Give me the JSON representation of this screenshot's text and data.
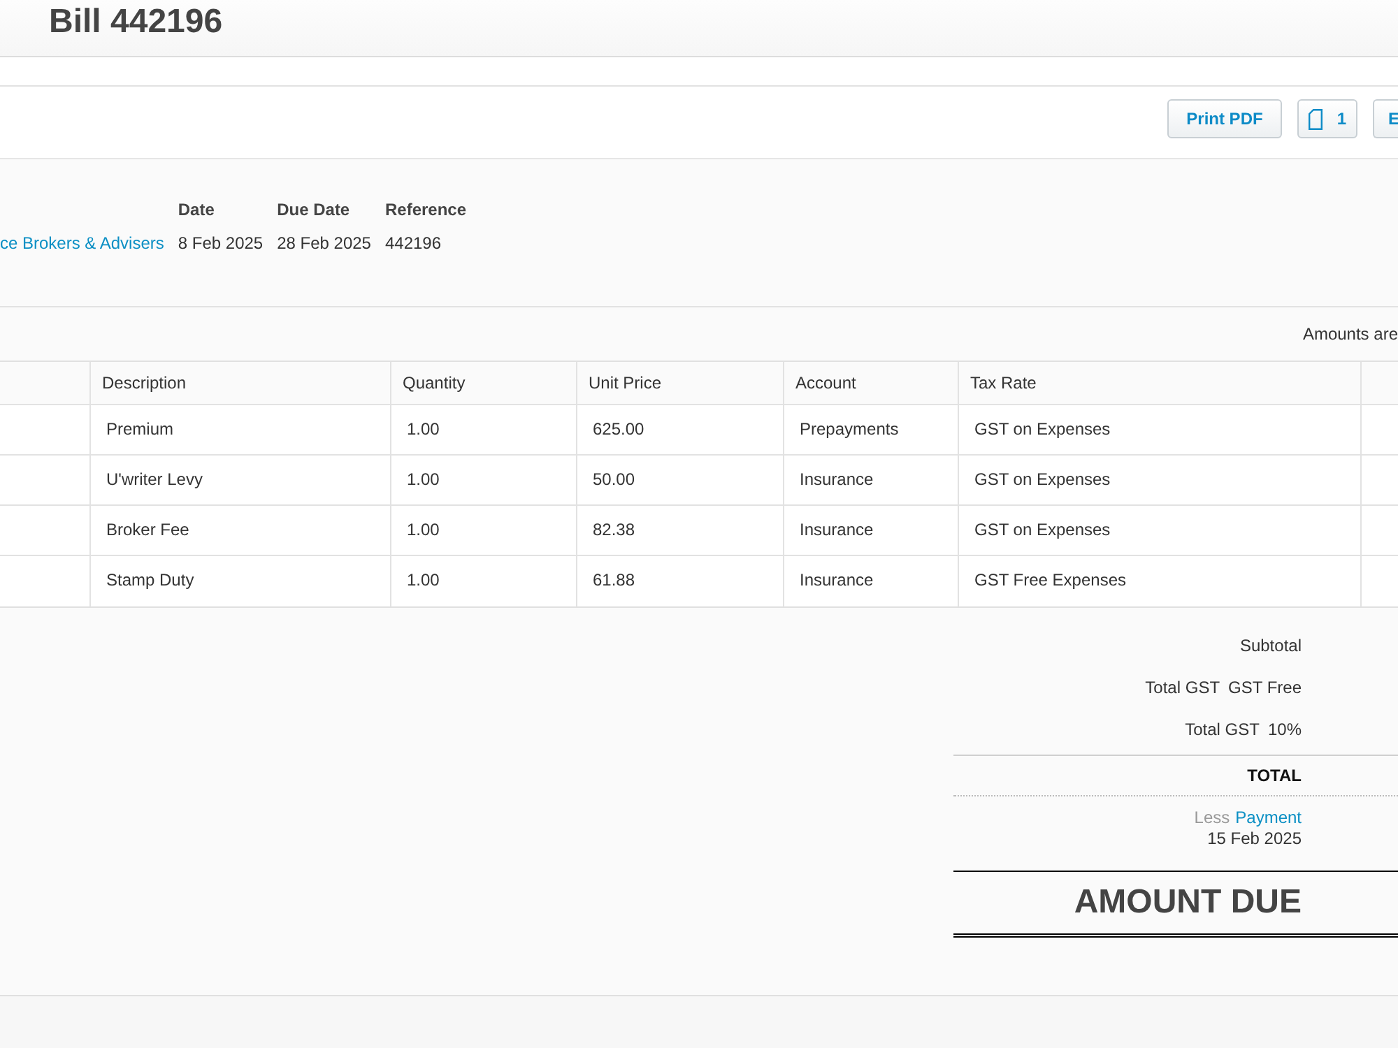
{
  "header": {
    "title": "Bill 442196"
  },
  "toolbar": {
    "buttons": [
      {
        "kind": "text",
        "label": "Print PDF"
      },
      {
        "kind": "attachments",
        "label": "1"
      },
      {
        "kind": "edge",
        "label": "E"
      }
    ]
  },
  "details": {
    "contact": "ce Brokers & Advisers",
    "fields": [
      {
        "label": "Date",
        "value": "8 Feb 2025"
      },
      {
        "label": "Due Date",
        "value": "28 Feb 2025"
      },
      {
        "label": "Reference",
        "value": "442196"
      }
    ]
  },
  "amounts_note": "Amounts are",
  "table": {
    "columns": [
      "Description",
      "Quantity",
      "Unit Price",
      "Account",
      "Tax Rate"
    ],
    "rows": [
      [
        "Premium",
        "1.00",
        "625.00",
        "Prepayments",
        "GST on Expenses"
      ],
      [
        "U'writer Levy",
        "1.00",
        "50.00",
        "Insurance",
        "GST on Expenses"
      ],
      [
        "Broker Fee",
        "1.00",
        "82.38",
        "Insurance",
        "GST on Expenses"
      ],
      [
        "Stamp Duty",
        "1.00",
        "61.88",
        "Insurance",
        "GST Free Expenses"
      ]
    ]
  },
  "totals": [
    {
      "kind": "subtotal",
      "label": "Subtotal"
    },
    {
      "kind": "tax",
      "label": "Total GST",
      "rate": "GST Free"
    },
    {
      "kind": "tax",
      "label": "Total GST",
      "rate": "10%"
    },
    {
      "kind": "total",
      "label": "TOTAL"
    },
    {
      "kind": "payment",
      "prefix": "Less",
      "link": "Payment",
      "date": "15 Feb 2025"
    },
    {
      "kind": "due",
      "label": "AMOUNT DUE"
    }
  ]
}
